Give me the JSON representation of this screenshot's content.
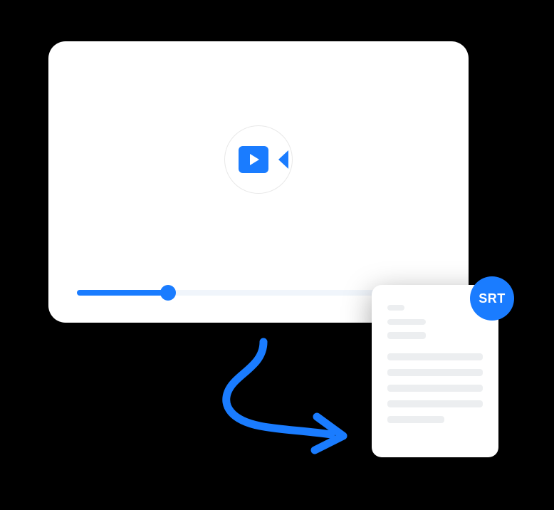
{
  "badge": {
    "label": "SRT"
  },
  "video": {
    "progressPercent": 25
  },
  "colors": {
    "accent": "#1a7cff"
  },
  "icons": {
    "camera": "video-camera-play-icon",
    "arrow": "curved-arrow-icon"
  }
}
